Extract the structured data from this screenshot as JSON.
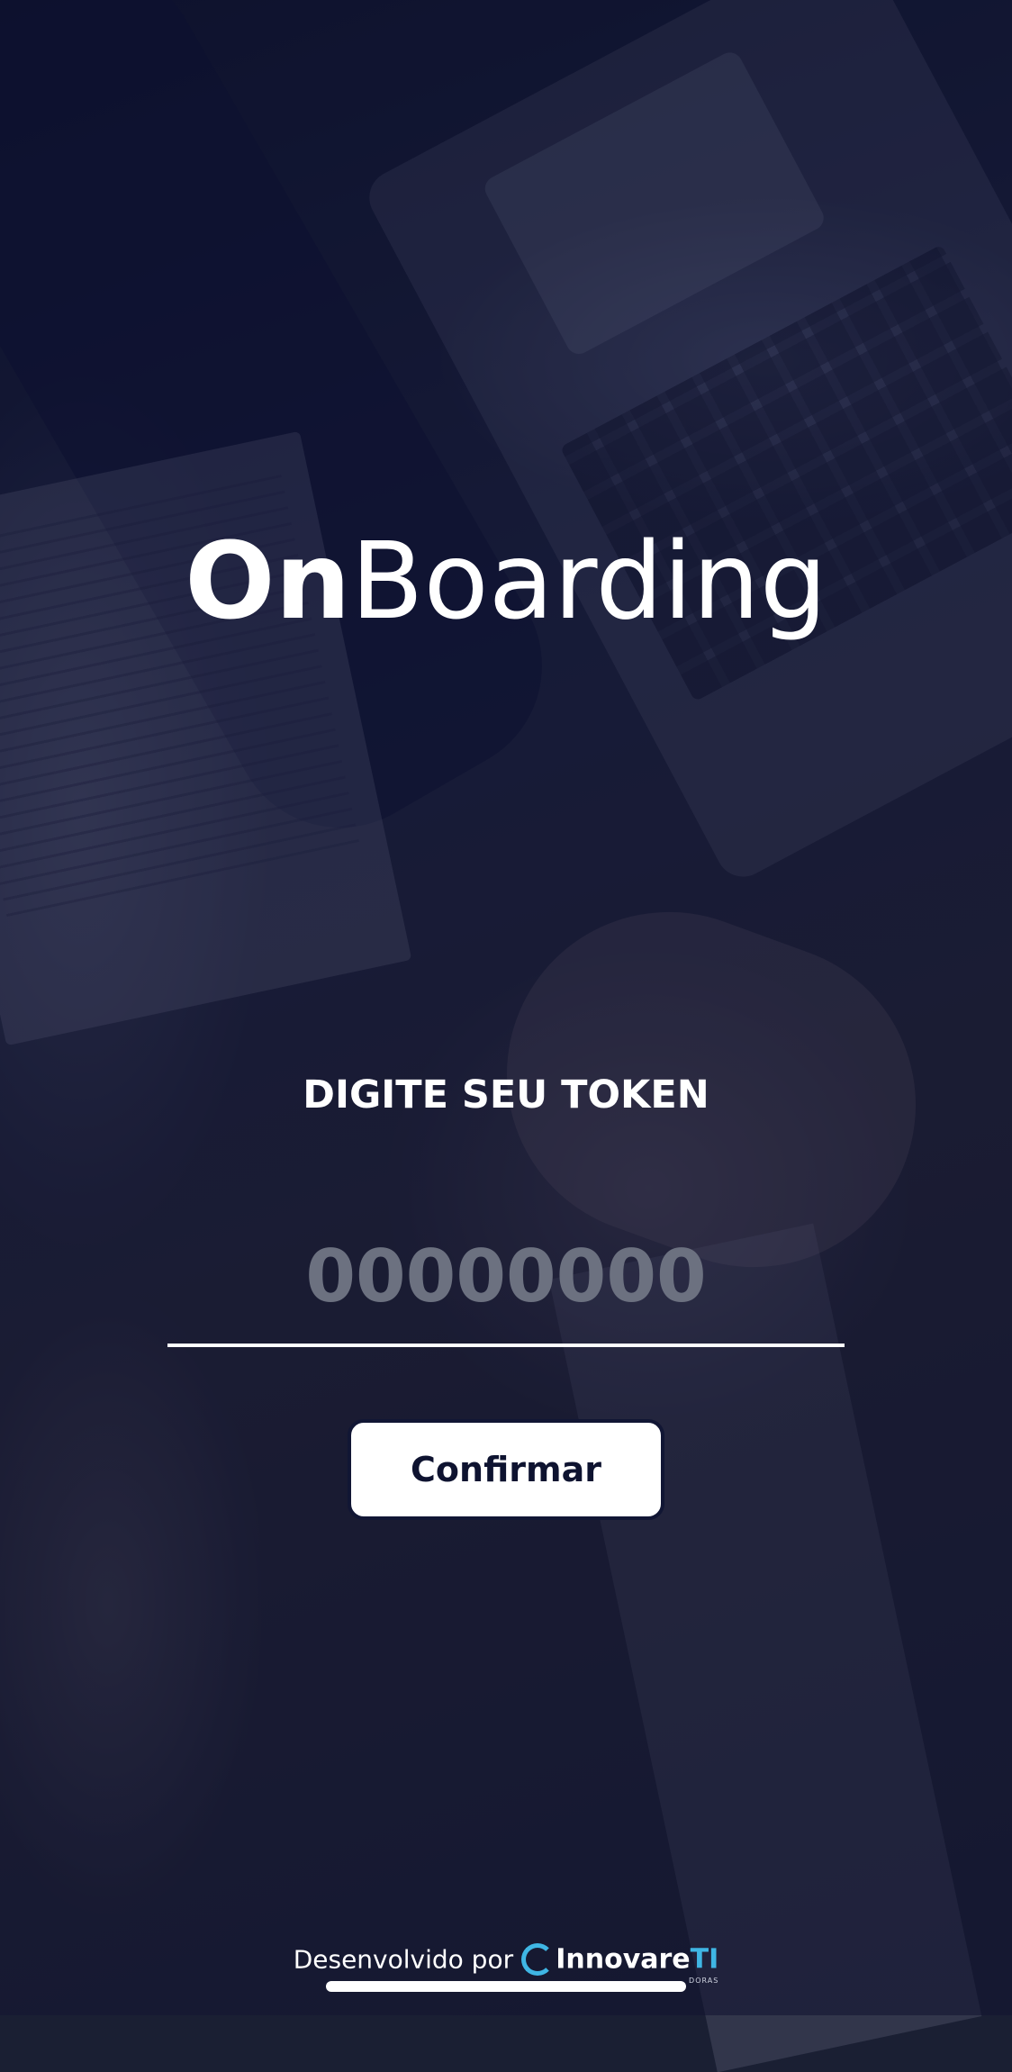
{
  "logo": {
    "bold_part": "On",
    "light_part": "Boarding"
  },
  "token": {
    "title": "DIGITE SEU TOKEN",
    "value": "",
    "placeholder": "00000000"
  },
  "confirm_button": {
    "label": "Confirmar"
  },
  "footer": {
    "text": "Desenvolvido por",
    "brand_name": "Innovare",
    "brand_suffix": "TI",
    "brand_tag": "DORAS"
  },
  "colors": {
    "overlay": "#0c1030",
    "text": "#ffffff",
    "placeholder": "#6c7180",
    "button_bg": "#ffffff",
    "button_text": "#0e1330",
    "brand_accent": "#3fb6e4"
  },
  "icons": {
    "brand_logo": "innovare-ring-icon"
  }
}
